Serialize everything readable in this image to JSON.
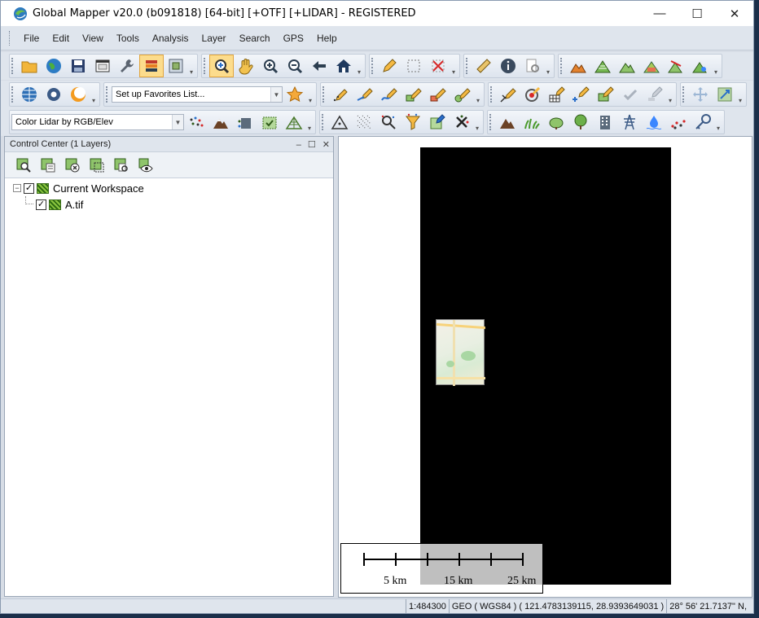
{
  "window": {
    "title": "Global Mapper v20.0 (b091818) [64-bit] [+OTF] [+LIDAR] - REGISTERED",
    "controls": {
      "minimize": "—",
      "maximize": "☐",
      "close": "✕"
    }
  },
  "menubar": {
    "items": [
      "File",
      "Edit",
      "View",
      "Tools",
      "Analysis",
      "Layer",
      "Search",
      "GPS",
      "Help"
    ]
  },
  "toolbar": {
    "favorites_combo": "Set up Favorites List...",
    "lidar_combo": "Color Lidar by RGB/Elev"
  },
  "control_center": {
    "title": "Control Center (1 Layers)",
    "header_controls": {
      "pin": "‒",
      "float": "☐",
      "close": "✕"
    },
    "tree": {
      "root_label": "Current Workspace",
      "root_expander": "−",
      "layers": [
        {
          "label": "A.tif",
          "checked": true
        }
      ],
      "root_checked": true
    }
  },
  "map": {
    "scale_labels": [
      "5 km",
      "15 km",
      "25 km"
    ]
  },
  "statusbar": {
    "scale": "1:484300",
    "projection": "GEO ( WGS84 ) ( 121.4783139115, 28.9393649031 )",
    "dms": "28° 56' 21.7137\" N,"
  },
  "colors": {
    "accent_active": "#fcdc8c",
    "raster_background": "#000000",
    "chrome": "#dfe5ed"
  }
}
